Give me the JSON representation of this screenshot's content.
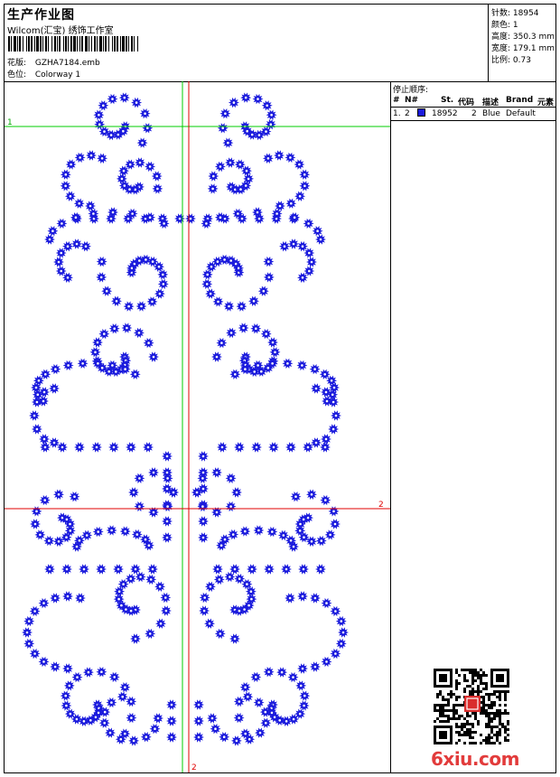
{
  "header": {
    "title": "生产作业图",
    "company": "Wilcom(汇宝) 绣饰工作室",
    "design_label": "花版:",
    "design_file": "GZHA7184.emb",
    "colorway_label": "色位:",
    "colorway_name": "Colorway 1"
  },
  "stats": {
    "stitches": "针数: 18954",
    "colors": "颜色: 1",
    "height": "高度: 350.3 mm",
    "width": "宽度: 179.1 mm",
    "scale": "比例: 0.73"
  },
  "guides": {
    "line1_label": "1",
    "line2_label_h": "2",
    "line2_label_v": "2",
    "green": "#00cc00",
    "red": "#e00000"
  },
  "stop_sequence": {
    "title": "停止顺序:",
    "columns": [
      "#",
      "N#",
      "St.",
      "代码",
      "描述",
      "Brand",
      "元素"
    ],
    "rows": [
      {
        "num": "1.",
        "needle": "2",
        "color": "#1a1adc",
        "stitches": "18952",
        "code": "2",
        "desc": "Blue",
        "brand": "Default",
        "element": ""
      }
    ]
  },
  "design": {
    "motif_color": "#1a1adc",
    "motif": "rhinestone-star"
  },
  "watermark": {
    "text": "6xiu.com"
  }
}
